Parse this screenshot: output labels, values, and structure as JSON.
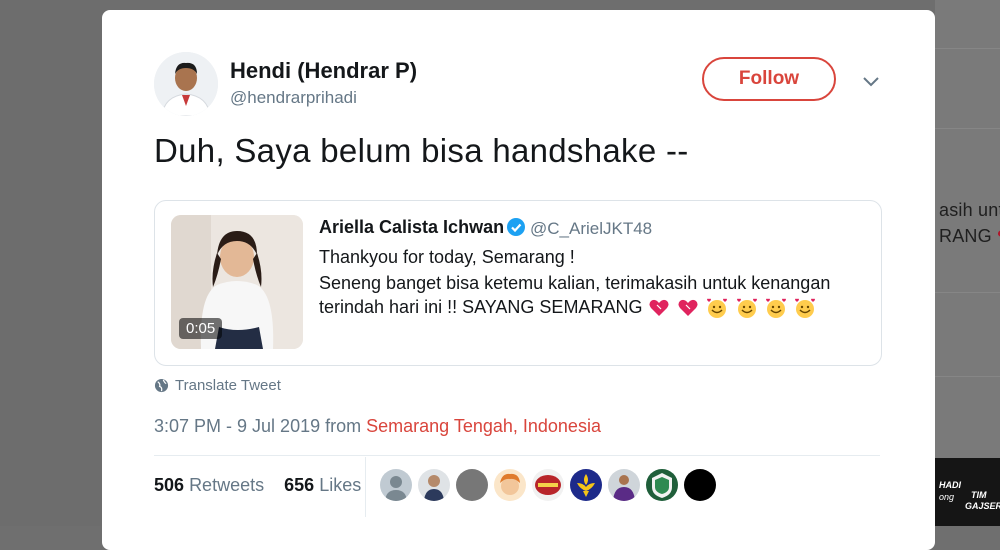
{
  "background": {
    "right_snippets": [
      "asih untu",
      "RANG"
    ],
    "thumb_text": [
      "HADI",
      "ong",
      "TIM",
      "GAJSER"
    ]
  },
  "tweet": {
    "author_name": "Hendi (Hendrar P)",
    "author_handle": "@hendrarprihadi",
    "follow_label": "Follow",
    "text": "Duh, Saya belum bisa handshake --",
    "translate_label": "Translate Tweet",
    "timestamp": "3:07 PM - 9 Jul 2019 from ",
    "location": "Semarang Tengah, Indonesia",
    "retweets_count": "506",
    "retweets_label": "Retweets",
    "likes_count": "656",
    "likes_label": "Likes"
  },
  "quoted": {
    "author_name": "Ariella Calista Ichwan",
    "author_handle": "@C_ArielJKT48",
    "video_duration": "0:05",
    "line1": "Thankyou for today, Semarang !",
    "line2": "Seneng banget bisa ketemu kalian, terimakasih untuk kenangan",
    "line3": "terindah hari ini !! SAYANG SEMARANG",
    "emojis": [
      "heart-icon",
      "heart-icon",
      "smiling-face-with-hearts-icon",
      "smiling-face-with-hearts-icon",
      "smiling-face-with-hearts-icon",
      "smiling-face-with-hearts-icon"
    ]
  },
  "colors": {
    "accent": "#d9453c",
    "muted": "#657786",
    "text": "#14171a",
    "verified": "#1da1f2"
  }
}
